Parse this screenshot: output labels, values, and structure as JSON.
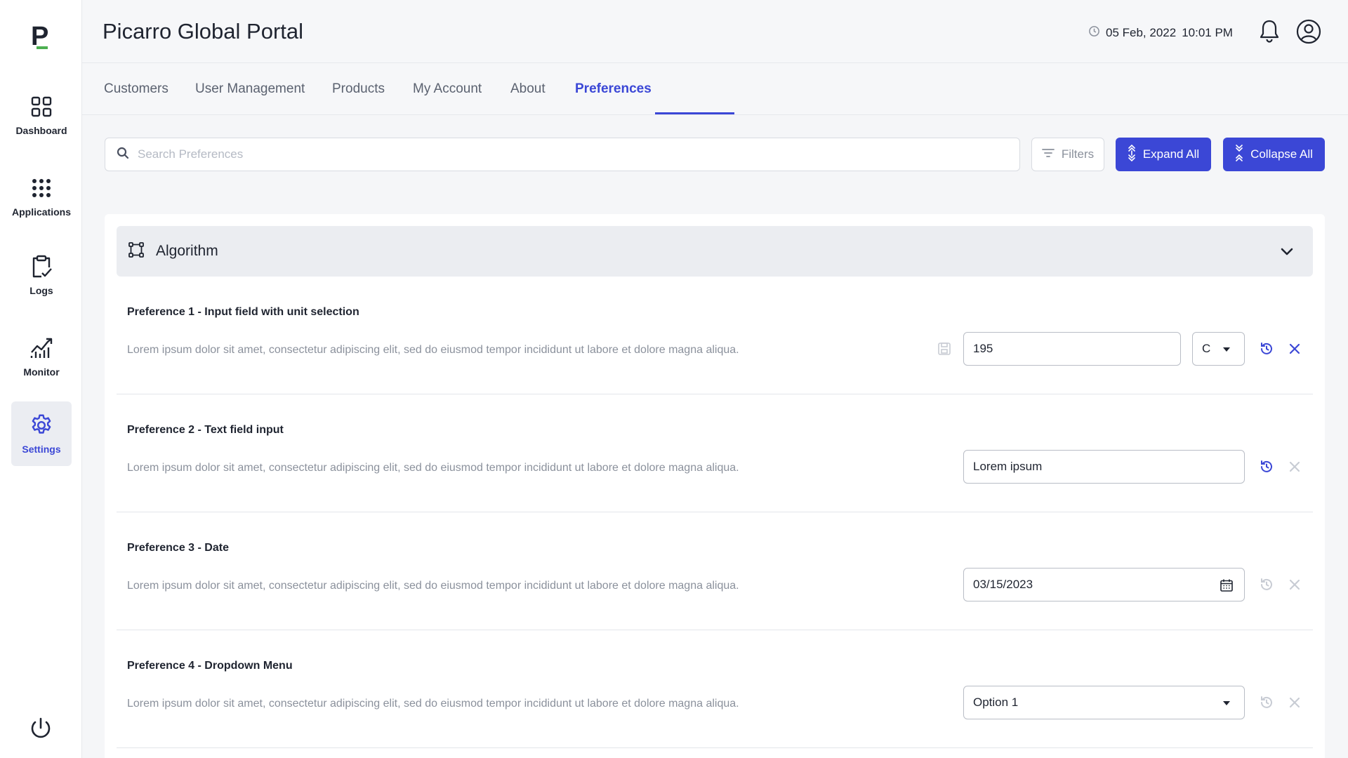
{
  "app": {
    "title": "Picarro Global Portal",
    "logo_letter": "P"
  },
  "header": {
    "date": "05 Feb, 2022",
    "time": "10:01 PM"
  },
  "sidebar": {
    "items": [
      {
        "label": "Dashboard",
        "icon": "grid-icon"
      },
      {
        "label": "Applications",
        "icon": "apps-dots-icon"
      },
      {
        "label": "Logs",
        "icon": "clipboard-check-icon"
      },
      {
        "label": "Monitor",
        "icon": "chart-line-icon"
      },
      {
        "label": "Settings",
        "icon": "gear-icon",
        "active": true
      }
    ]
  },
  "tabs": [
    {
      "label": "Customers"
    },
    {
      "label": "User Management"
    },
    {
      "label": "Products"
    },
    {
      "label": "My Account"
    },
    {
      "label": "About"
    },
    {
      "label": "Preferences",
      "active": true
    }
  ],
  "toolbar": {
    "search_placeholder": "Search Preferences",
    "filters_label": "Filters",
    "expand_label": "Expand All",
    "collapse_label": "Collapse All"
  },
  "section": {
    "title": "Algorithm",
    "icon": "algorithm-icon"
  },
  "preferences": [
    {
      "title": "Preference 1 - Input field with unit selection",
      "description": "Lorem ipsum dolor sit amet, consectetur adipiscing elit, sed do eiusmod tempor incididunt ut labore et dolore magna aliqua.",
      "value": "195",
      "unit": "C"
    },
    {
      "title": "Preference 2 - Text field input",
      "description": "Lorem ipsum dolor sit amet, consectetur adipiscing elit, sed do eiusmod tempor incididunt ut labore et dolore magna aliqua.",
      "value": "Lorem ipsum"
    },
    {
      "title": "Preference 3 - Date",
      "description": "Lorem ipsum dolor sit amet, consectetur adipiscing elit, sed do eiusmod tempor incididunt ut labore et dolore magna aliqua.",
      "value": "03/15/2023"
    },
    {
      "title": "Preference 4 - Dropdown Menu",
      "description": "Lorem ipsum dolor sit amet, consectetur adipiscing elit, sed do eiusmod tempor incididunt ut labore et dolore magna aliqua.",
      "value": "Option 1"
    }
  ],
  "colors": {
    "accent": "#3b47d6",
    "logo_green": "#4caf50",
    "disabled_icon": "#c8ccd4"
  }
}
